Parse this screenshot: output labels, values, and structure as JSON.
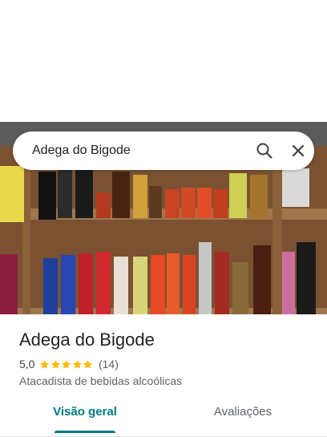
{
  "search": {
    "query": "Adega do Bigode"
  },
  "place": {
    "name": "Adega do Bigode",
    "rating": "5,0",
    "stars": 5,
    "review_count": "(14)",
    "category": "Atacadista de bebidas alcoólicas"
  },
  "tabs": {
    "overview": "Visão geral",
    "reviews": "Avaliações"
  },
  "colors": {
    "accent": "#007b83",
    "star": "#fbbc04"
  },
  "icons": {
    "search": "search-icon",
    "close": "close-icon"
  }
}
